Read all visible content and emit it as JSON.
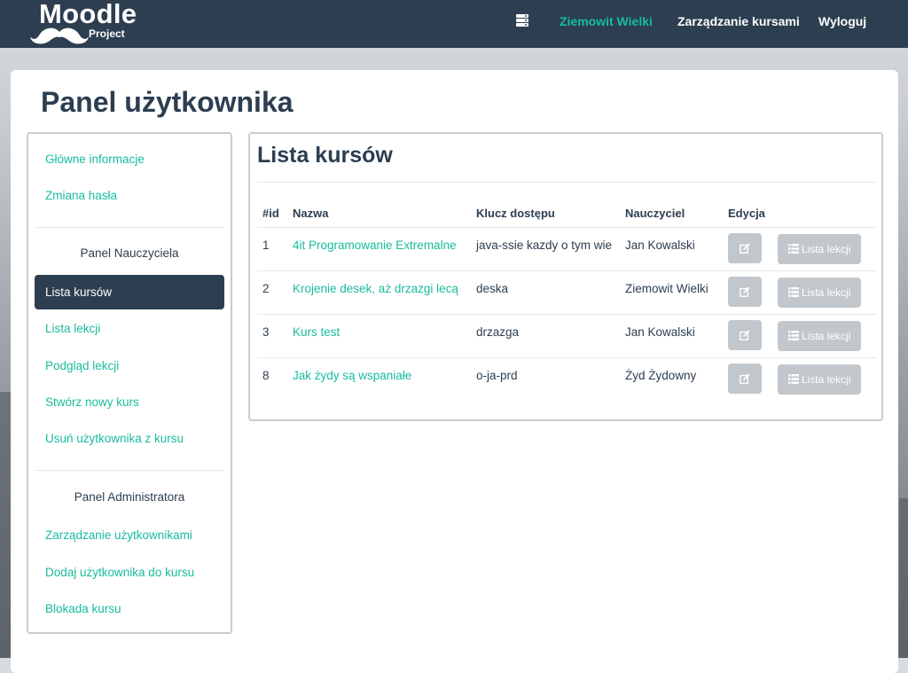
{
  "brand": {
    "title": "Moodle",
    "subtitle": "Project"
  },
  "nav": {
    "user": "Ziemowit Wielki",
    "manage": "Zarządzanie kursami",
    "logout": "Wyloguj",
    "icon": "server-icon"
  },
  "page": {
    "title": "Panel użytkownika"
  },
  "sidebar": {
    "general": [
      "Główne informacje",
      "Zmiana hasła"
    ],
    "teacher_heading": "Panel Nauczyciela",
    "active_item": "Lista kursów",
    "teacher_items": [
      "Lista lekcji",
      "Podgląd lekcji",
      "Stwórz nowy kurs",
      "Usuń użytkownika z kursu"
    ],
    "admin_heading": "Panel Administratora",
    "admin_items": [
      "Zarządzanie użytkownikami",
      "Dodaj użytkownika do kursu",
      "Blokada kursu"
    ]
  },
  "content": {
    "title": "Lista kursów",
    "columns": [
      "#id",
      "Nazwa",
      "Klucz dostępu",
      "Nauczyciel",
      "Edycja",
      ""
    ],
    "lessons_button_label": "Lista lekcji",
    "rows": [
      {
        "id": "1",
        "name": "4it Programowanie Extremalne",
        "key": "java-ssie kazdy o tym wie",
        "teacher": "Jan Kowalski"
      },
      {
        "id": "2",
        "name": "Krojenie desek, aż drzazgi lecą",
        "key": "deska",
        "teacher": "Ziemowit Wielki"
      },
      {
        "id": "3",
        "name": "Kurs test",
        "key": "drzazga",
        "teacher": "Jan Kowalski"
      },
      {
        "id": "8",
        "name": "Jak żydy są wspaniałe",
        "key": "o-ja-prd",
        "teacher": "Żyd Żydowny"
      }
    ]
  },
  "colors": {
    "navbar": "#2c3e50",
    "accent": "#18bc9c",
    "button_disabled": "#c2c7cc"
  }
}
